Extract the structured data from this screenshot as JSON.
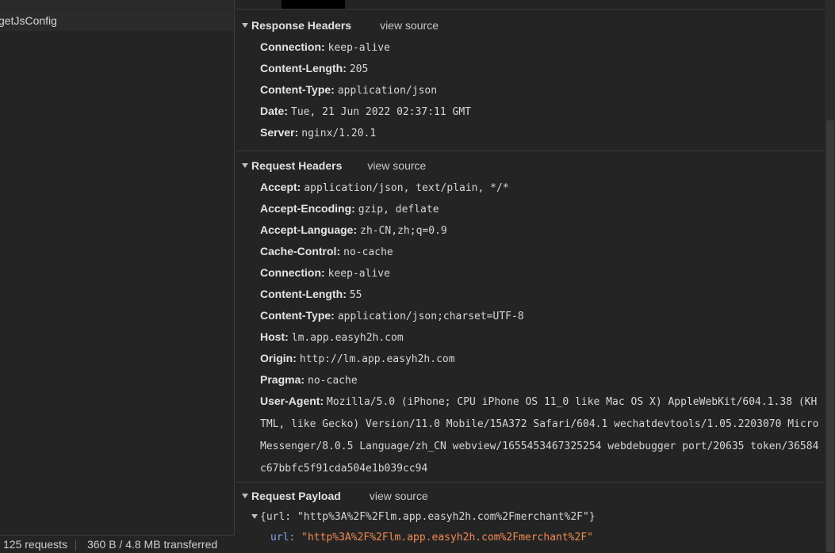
{
  "left": {
    "selected_item": "getJsConfig",
    "status": {
      "requests": "125 requests",
      "transferred": "360 B / 4.8 MB transferred"
    }
  },
  "response_headers": {
    "title": "Response Headers",
    "view_source": "view source",
    "items": [
      {
        "k": "Connection:",
        "v": "keep-alive"
      },
      {
        "k": "Content-Length:",
        "v": "205"
      },
      {
        "k": "Content-Type:",
        "v": "application/json"
      },
      {
        "k": "Date:",
        "v": "Tue, 21 Jun 2022 02:37:11 GMT"
      },
      {
        "k": "Server:",
        "v": "nginx/1.20.1"
      }
    ]
  },
  "request_headers": {
    "title": "Request Headers",
    "view_source": "view source",
    "items": [
      {
        "k": "Accept:",
        "v": "application/json, text/plain, */*"
      },
      {
        "k": "Accept-Encoding:",
        "v": "gzip, deflate"
      },
      {
        "k": "Accept-Language:",
        "v": "zh-CN,zh;q=0.9"
      },
      {
        "k": "Cache-Control:",
        "v": "no-cache"
      },
      {
        "k": "Connection:",
        "v": "keep-alive"
      },
      {
        "k": "Content-Length:",
        "v": "55"
      },
      {
        "k": "Content-Type:",
        "v": "application/json;charset=UTF-8"
      },
      {
        "k": "Host:",
        "v": "lm.app.easyh2h.com"
      },
      {
        "k": "Origin:",
        "v": "http://lm.app.easyh2h.com"
      },
      {
        "k": "Pragma:",
        "v": "no-cache"
      }
    ],
    "user_agent": {
      "k": "User-Agent:",
      "v": "Mozilla/5.0 (iPhone; CPU iPhone OS 11_0 like Mac OS X) AppleWebKit/604.1.38 (KHTML, like Gecko) Version/11.0 Mobile/15A372 Safari/604.1 wechatdevtools/1.05.2203070 MicroMessenger/8.0.5 Language/zh_CN webview/1655453467325254 webdebugger port/20635 token/36584c67bbfc5f91cda504e1b039cc94"
    }
  },
  "request_payload": {
    "title": "Request Payload",
    "view_source": "view source",
    "summary": "{url: \"http%3A%2F%2Flm.app.easyh2h.com%2Fmerchant%2F\"}",
    "key": "url:",
    "value": "\"http%3A%2F%2Flm.app.easyh2h.com%2Fmerchant%2F\""
  }
}
